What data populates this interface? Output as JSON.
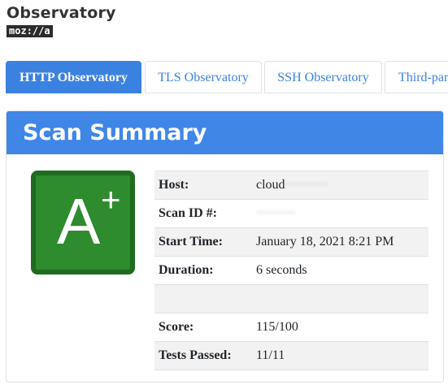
{
  "brand": {
    "title": "Observatory",
    "logo_text": "moz://a"
  },
  "tabs": [
    {
      "label": "HTTP Observatory",
      "active": true
    },
    {
      "label": "TLS Observatory",
      "active": false
    },
    {
      "label": "SSH Observatory",
      "active": false
    },
    {
      "label": "Third-party Tests",
      "active": false
    }
  ],
  "summary": {
    "title": "Scan Summary",
    "grade": {
      "letter": "A",
      "modifier": "+"
    },
    "rows": [
      {
        "label": "Host:",
        "value": "cloud"
      },
      {
        "label": "Scan ID #:",
        "value": ""
      },
      {
        "label": "Start Time:",
        "value": "January 18, 2021 8:21 PM"
      },
      {
        "label": "Duration:",
        "value": "6 seconds"
      },
      {
        "label": "",
        "value": ""
      },
      {
        "label": "Score:",
        "value": "115/100"
      },
      {
        "label": "Tests Passed:",
        "value": "11/11"
      }
    ]
  },
  "colors": {
    "accent": "#4086e6",
    "grade_bg": "#2e8b2e",
    "grade_border": "#1f6b1f"
  }
}
